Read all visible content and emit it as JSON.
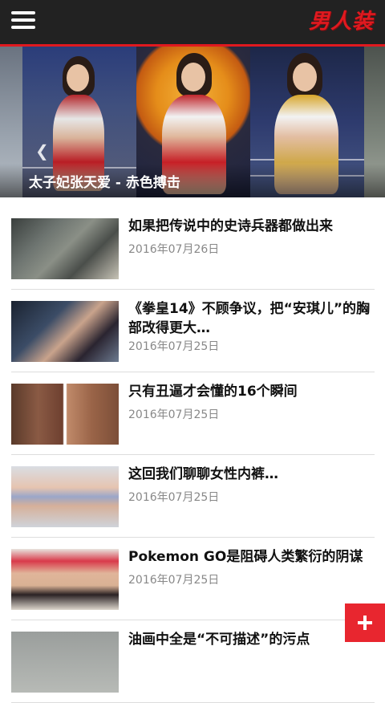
{
  "header": {
    "logo_text": "男人装",
    "menu_icon": "hamburger-menu-icon",
    "accent_color": "#e0191f"
  },
  "banner": {
    "caption": "太子妃张天爱 - 赤色搏击",
    "arrow_left_icon": "chevron-left-icon"
  },
  "articles": [
    {
      "title": "如果把传说中的史诗兵器都做出来",
      "date": "2016年07月26日"
    },
    {
      "title": "《拳皇14》不顾争议，把“安琪儿”的胸部改得更大…",
      "date": "2016年07月25日"
    },
    {
      "title": "只有丑逼才会懂的16个瞬间",
      "date": "2016年07月25日"
    },
    {
      "title": "这回我们聊聊女性内裤…",
      "date": "2016年07月25日"
    },
    {
      "title": "Pokemon GO是阻碍人类繁衍的阴谋",
      "date": "2016年07月25日"
    },
    {
      "title": "油画中全是“不可描述”的污点",
      "date": ""
    }
  ],
  "fab": {
    "icon": "plus-icon",
    "color": "#e8262f"
  }
}
